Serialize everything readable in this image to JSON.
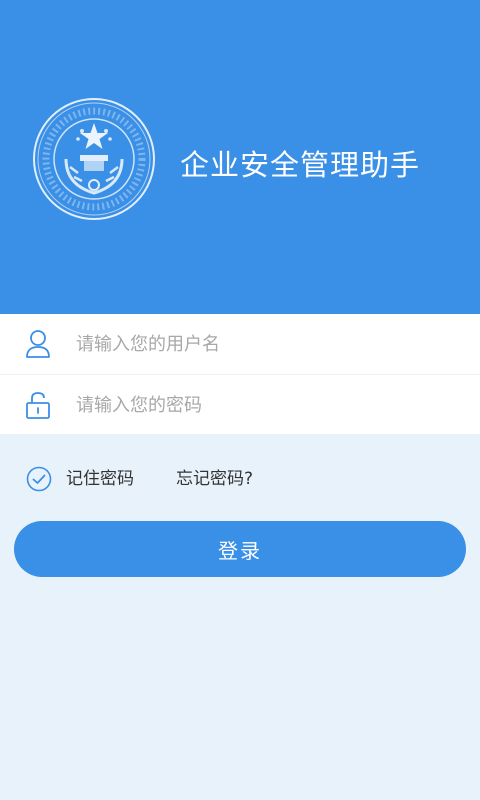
{
  "app": {
    "title": "企业安全管理助手",
    "emblem_icon": "national-emblem-seal-icon"
  },
  "login_form": {
    "username_placeholder": "请输入您的用户名",
    "username_icon": "user-icon",
    "password_placeholder": "请输入您的密码",
    "password_icon": "lock-icon"
  },
  "options": {
    "remember_label": "记住密码",
    "remember_checked": true,
    "remember_icon": "check-circle-icon",
    "forgot_label": "忘记密码?"
  },
  "actions": {
    "login_label": "登录"
  },
  "colors": {
    "primary": "#3a8fe6",
    "background": "#e8f2fb",
    "field_bg": "#ffffff",
    "placeholder": "#a8a8a8"
  }
}
